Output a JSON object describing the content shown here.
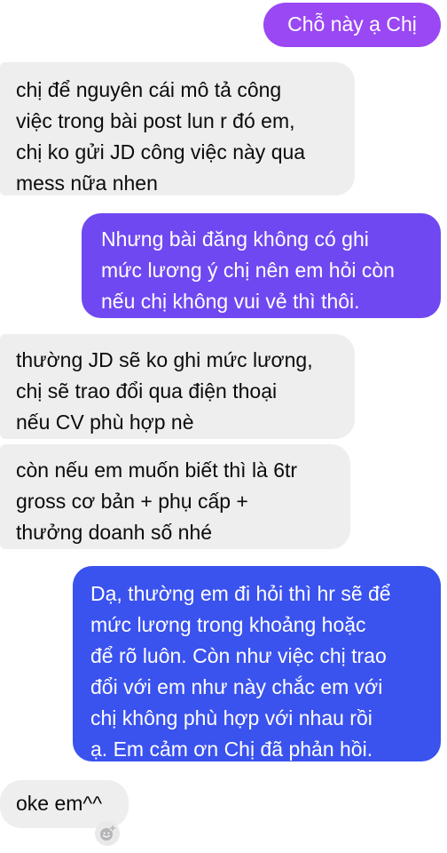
{
  "colors": {
    "outgoing_top": "#9a47f4",
    "outgoing_mid": "#6f48f1",
    "outgoing_bottom": "#3a52ee",
    "incoming": "#eeeeef",
    "incoming_text": "#0b0b0b",
    "outgoing_text": "#ffffff"
  },
  "messages": [
    {
      "sender": "me",
      "lines": [
        "Chỗ này ạ Chị"
      ]
    },
    {
      "sender": "other",
      "lines": [
        "chị để nguyên cái mô tả công",
        "việc trong bài post lun r đó em,",
        "chị ko gửi JD công việc này qua",
        "mess nữa nhen"
      ]
    },
    {
      "sender": "me",
      "lines": [
        "Nhưng bài đăng không có ghi",
        "mức lương ý chị nên em hỏi còn",
        "nếu chị không vui vẻ thì thôi."
      ]
    },
    {
      "sender": "other",
      "lines": [
        "thường JD sẽ ko ghi mức lương,",
        "chị sẽ trao đổi qua điện thoại",
        "nếu CV phù hợp nè"
      ]
    },
    {
      "sender": "other",
      "lines": [
        "còn nếu em muốn biết thì là 6tr",
        "gross cơ bản + phụ cấp +",
        "thưởng doanh số nhé"
      ]
    },
    {
      "sender": "me",
      "lines": [
        "Dạ, thường em đi hỏi thì hr sẽ để",
        "mức lương trong khoảng hoặc",
        "để rõ luôn. Còn như việc chị trao",
        "đổi với em như này chắc em với",
        "chị không phù hợp với nhau rồi",
        "ạ. Em cảm ơn Chị đã phản hồi."
      ]
    },
    {
      "sender": "other",
      "lines": [
        "oke em^^"
      ]
    }
  ],
  "reaction_button": {
    "icon": "add-reaction-icon"
  }
}
